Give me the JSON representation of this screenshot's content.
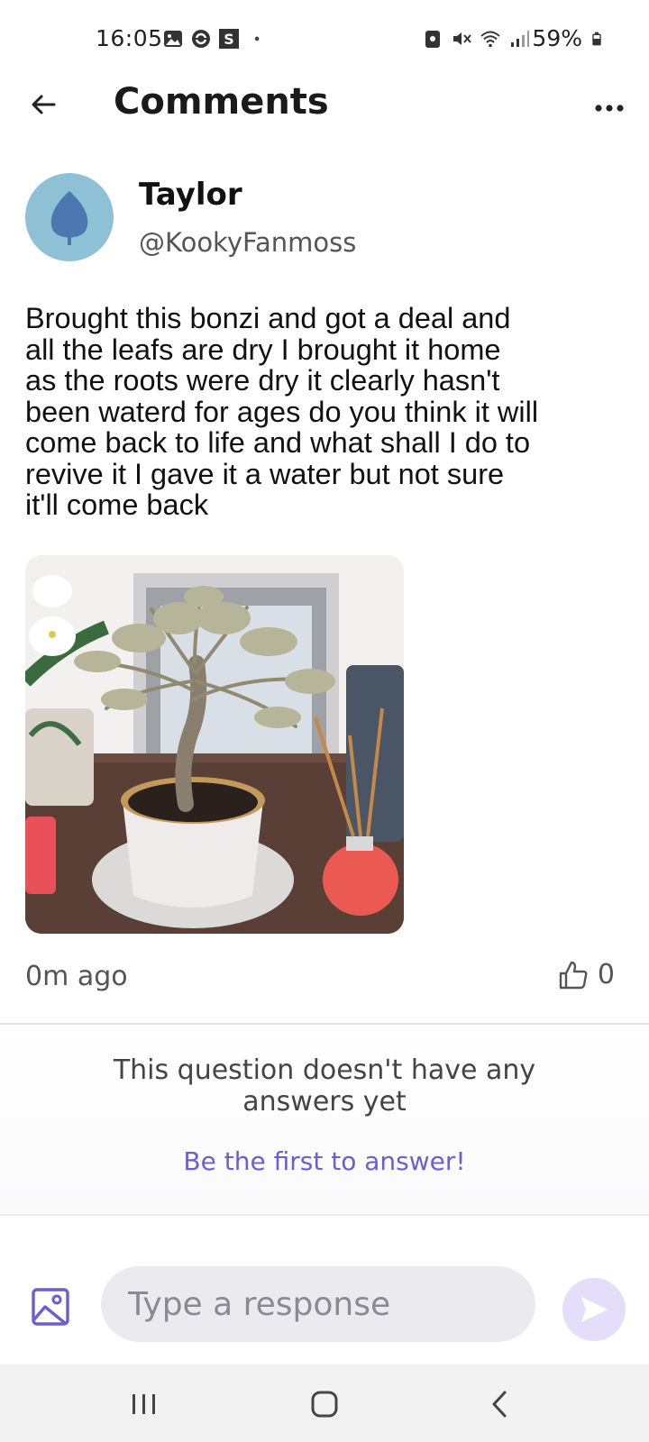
{
  "status_bar": {
    "time": "16:05",
    "battery": "59%",
    "left_icons": [
      "gallery-icon",
      "sync-icon",
      "s-app-icon",
      "dot-icon"
    ],
    "right_icons": [
      "lock-icon",
      "mute-icon",
      "wifi-icon",
      "signal-icon",
      "battery-icon"
    ]
  },
  "header": {
    "title": "Comments",
    "back_icon": "arrow-left-icon",
    "more_icon": "more-dots-icon"
  },
  "author": {
    "name": "Taylor",
    "handle": "@KookyFanmoss",
    "avatar_color": "#8ec1d6",
    "avatar_icon": "leaf-icon"
  },
  "post": {
    "text": "Brought this bonzi and got a deal and\nall the leafs are dry I brought it home\nas the roots were dry it clearly hasn't\nbeen waterd for ages do you think it will\ncome back to life and what shall I do to\nrevive it I gave it a water but not sure\nit'll come back",
    "image_alt": "bonsai-photo",
    "time": "0m ago",
    "likes": "0"
  },
  "answers": {
    "empty_message": "This question doesn't have any\nanswers yet",
    "cta": "Be the first to answer!",
    "cta_color": "#6b5fd0"
  },
  "composer": {
    "placeholder": "Type a response",
    "image_icon": "image-icon",
    "send_icon": "send-icon",
    "accent_color": "#6b5fd0"
  },
  "nav": {
    "icons": [
      "recents-icon",
      "home-icon",
      "back-icon"
    ]
  }
}
